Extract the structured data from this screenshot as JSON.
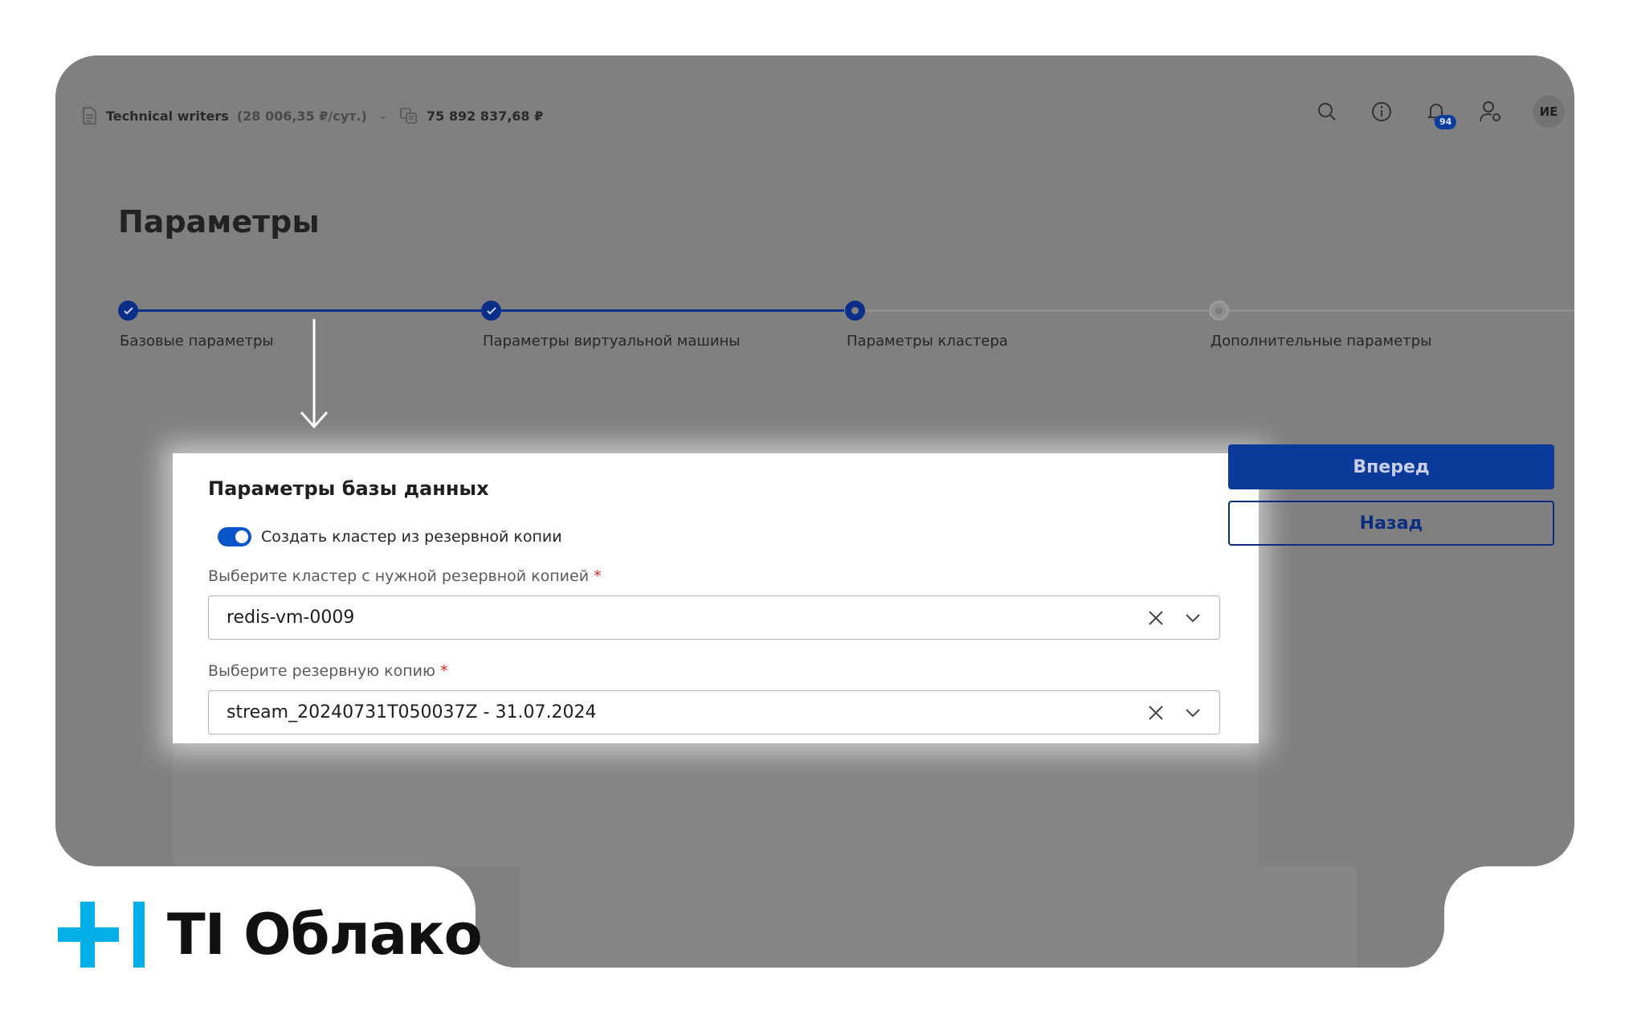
{
  "topbar": {
    "project_name": "Technical writers",
    "project_cost": "(28 006,35 ₽/сут.)",
    "balance": "75 892 837,68 ₽",
    "notifications_count": "94",
    "avatar_initials": "ИЕ"
  },
  "page": {
    "title": "Параметры"
  },
  "stepper": {
    "steps": [
      {
        "label": "Базовые параметры",
        "state": "done"
      },
      {
        "label": "Параметры виртуальной машины",
        "state": "done"
      },
      {
        "label": "Параметры кластера",
        "state": "current"
      },
      {
        "label": "Дополнительные параметры",
        "state": "todo"
      }
    ]
  },
  "card": {
    "title": "Параметры базы данных",
    "toggle_label": "Создать кластер из резервной копии",
    "toggle_on": true,
    "cluster_label": "Выберите кластер с нужной резервной копией",
    "cluster_value": "redis-vm-0009",
    "backup_label": "Выберите резервную копию",
    "backup_value": "stream_20240731T050037Z - 31.07.2024",
    "required_mark": "*"
  },
  "actions": {
    "next_label": "Вперед",
    "back_label": "Назад"
  },
  "brand": {
    "logo_text": "TI Облако"
  },
  "colors": {
    "primary": "#0b3a9a",
    "toggle": "#0a55c8",
    "logo_accent": "#00aee8",
    "required": "#d42a2a"
  }
}
